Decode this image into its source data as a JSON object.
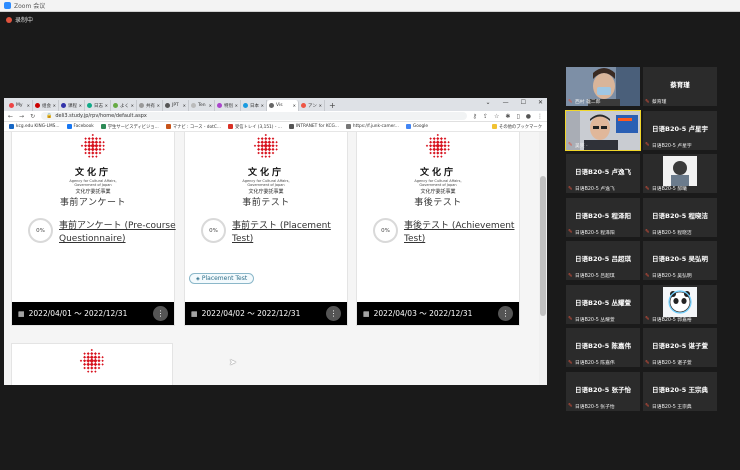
{
  "zoom": {
    "title": "Zoom 会议",
    "recording": "录制中"
  },
  "browser": {
    "tabs": [
      {
        "label": "My",
        "color": "#e44"
      },
      {
        "label": "组会",
        "color": "#c00"
      },
      {
        "label": "课程",
        "color": "#33a"
      },
      {
        "label": "日志",
        "color": "#1a8"
      },
      {
        "label": "よく",
        "color": "#6a4"
      },
      {
        "label": "共有",
        "color": "#999"
      },
      {
        "label": "JPT",
        "color": "#555"
      },
      {
        "label": "Ten",
        "color": "#bbb"
      },
      {
        "label": "特別",
        "color": "#a4c"
      },
      {
        "label": "日本",
        "color": "#1a9be0"
      },
      {
        "label": "Vis",
        "color": "#666",
        "active": true
      },
      {
        "label": "アン",
        "color": "#e54"
      }
    ],
    "url": "deli3.study.jp/rpv/home/default.aspx",
    "bookmarks": [
      {
        "label": "kcg.edu KING-LMS...",
        "color": "#1667c5"
      },
      {
        "label": "Facebook",
        "color": "#1877f2"
      },
      {
        "label": "学生サービスディビジョ...",
        "color": "#2e8b57"
      },
      {
        "label": "マナビ : コース - dotC...",
        "color": "#c7541a"
      },
      {
        "label": "受信トレイ (3,151) - ...",
        "color": "#d93025"
      },
      {
        "label": "INTRANET for KCG...",
        "color": "#555"
      },
      {
        "label": "https://f.junk-camer...",
        "color": "#777"
      },
      {
        "label": "Google",
        "color": "#4285f4"
      }
    ],
    "bookmarks_other": "その他のブックマーク"
  },
  "logo": {
    "name": "文化庁",
    "en": "Agency for Cultural Affairs, Government of Japan",
    "jp": "文化庁委託事業"
  },
  "cards": [
    {
      "category": "事前アンケート",
      "progress": "0%",
      "title": "事前アンケート (Pre-course Questionnaire)",
      "tag": "",
      "date": "2022/04/01 ～ 2022/12/31"
    },
    {
      "category": "事前テスト",
      "progress": "0%",
      "title": "事前テスト (Placement Test)",
      "tag": "Placement Test",
      "date": "2022/04/02 ～ 2022/12/31"
    },
    {
      "category": "事後テスト",
      "progress": "0%",
      "title": "事後テスト (Achievement Test)",
      "tag": "",
      "date": "2022/04/03 ～ 2022/12/31"
    }
  ],
  "participants": [
    {
      "name": "",
      "label": "西村 雄二郎",
      "photo": "woman"
    },
    {
      "name": "蔡育瑾",
      "label": "蔡育瑾"
    },
    {
      "name": "",
      "label": "吴笑 ·",
      "photo": "man"
    },
    {
      "name": "日语B20-5 卢星宇",
      "label": "日语B20-5 卢星宇"
    },
    {
      "name": "日语B20-5 卢逸飞",
      "label": "日语B20-5 卢逸飞"
    },
    {
      "name": "",
      "label": "日语B20-5 郝曦",
      "photo": "avatar"
    },
    {
      "name": "日语B20-5 程泽阳",
      "label": "日语B20-5 程泽阳"
    },
    {
      "name": "日语B20-5 程晓洁",
      "label": "日语B20-5 程晓洁"
    },
    {
      "name": "日语B20-5 吕超琪",
      "label": "日语B20-5 吕超琪"
    },
    {
      "name": "日语B20-5 吴弘明",
      "label": "日语B20-5 吴弘明"
    },
    {
      "name": "日语B20-5 丛耀萱",
      "label": "日语B20-5 丛耀萱"
    },
    {
      "name": "",
      "label": "日语B20-5 郭嘉裕",
      "photo": "panda"
    },
    {
      "name": "日语B20-5 陈嘉伟",
      "label": "日语B20-5 陈嘉伟"
    },
    {
      "name": "日语B20-5 谌子萱",
      "label": "日语B20-5 谌子萱"
    },
    {
      "name": "日语B20-5 张子怡",
      "label": "日语B20-5 张子怡"
    },
    {
      "name": "日语B20-5 王宗典",
      "label": "日语B20-5 王宗典"
    }
  ]
}
